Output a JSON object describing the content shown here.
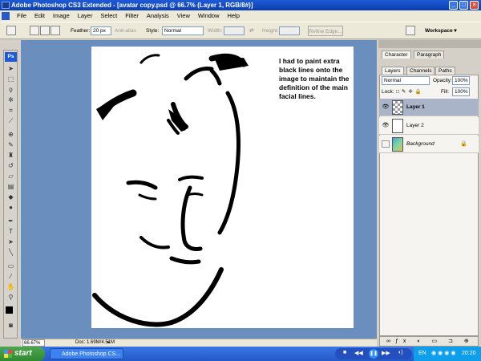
{
  "window": {
    "title": "Adobe Photoshop CS3 Extended - [avatar copy.psd @ 66.7% (Layer 1, RGB/8#)]",
    "min": "_",
    "max": "□",
    "close": "×"
  },
  "menu": [
    "File",
    "Edit",
    "Image",
    "Layer",
    "Select",
    "Filter",
    "Analysis",
    "View",
    "Window",
    "Help"
  ],
  "options": {
    "feather_label": "Feather:",
    "feather_value": "20 px",
    "antialias_label": "Anti-alias",
    "style_label": "Style:",
    "style_value": "Normal",
    "width_label": "Width:",
    "height_label": "Height:",
    "refine_label": "Refine Edge...",
    "workspace_label": "Workspace ▾"
  },
  "canvas": {
    "note": "I had to paint extra black lines onto the image to maintain the definition of the main facial lines."
  },
  "status": {
    "zoom": "66.67%",
    "doc": "Doc: 1.69M/4.51M"
  },
  "panels": {
    "top_tabs": [
      "Character",
      "Paragraph"
    ],
    "layer_tabs": [
      "Layers",
      "Channels",
      "Paths"
    ],
    "blend_mode": "Normal",
    "opacity_label": "Opacity:",
    "opacity_value": "100%",
    "lock_label": "Lock:",
    "fill_label": "Fill:",
    "fill_value": "100%",
    "layers": [
      {
        "name": "Layer 1",
        "selected": true
      },
      {
        "name": "Layer 2",
        "selected": false
      },
      {
        "name": "Background",
        "selected": false
      }
    ]
  },
  "taskbar": {
    "start": "start",
    "task": "Adobe Photoshop CS...",
    "lang": "EN",
    "time": "20:20"
  },
  "icons": [
    "ps-logo-icon",
    "eye-icon",
    "lock-icon",
    "play-icon",
    "pause-icon",
    "stop-icon"
  ],
  "colors": {
    "workspace": "#6a8fbf",
    "titlebar": "#1f5ad6",
    "selected_layer": "#a9b4c8"
  }
}
